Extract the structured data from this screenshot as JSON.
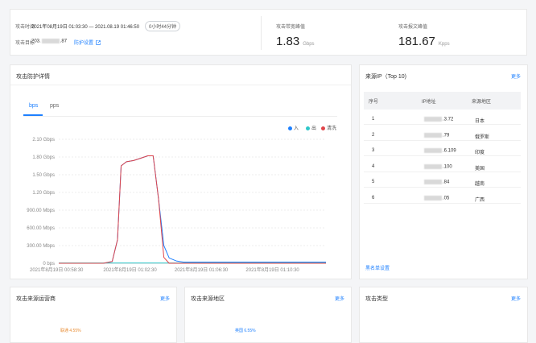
{
  "summary": {
    "attack_time_label": "攻击时间",
    "attack_time_value": "2021年08月19日 01:03:30 — 2021.08.19 01:46:50",
    "duration": "0小时44分钟",
    "attack_target_label": "攻击目标",
    "target_ip_prefix": "203.",
    "target_ip_suffix": ".87",
    "protect_settings_link": "防护设置",
    "bandwidth_peak_label": "攻击带宽峰值",
    "bandwidth_peak_value": "1.83",
    "bandwidth_peak_unit": "Gbps",
    "packet_peak_label": "攻击报文峰值",
    "packet_peak_value": "181.67",
    "packet_peak_unit": "Kpps"
  },
  "protection": {
    "title": "攻击防护详情",
    "tabs": [
      "bps",
      "pps"
    ],
    "active_tab": "bps",
    "legend": [
      {
        "name": "入",
        "color": "#1e80ff"
      },
      {
        "name": "出",
        "color": "#2ec7c9"
      },
      {
        "name": "清洗",
        "color": "#e0454a"
      }
    ]
  },
  "chart_data": {
    "type": "line",
    "title": "",
    "xlabel": "",
    "ylabel": "",
    "y_tick_labels": [
      "0 bps",
      "300.00 Mbps",
      "600.00 Mbps",
      "900.00 Mbps",
      "1.20 Gbps",
      "1.50 Gbps",
      "1.80 Gbps",
      "2.10 Gbps"
    ],
    "y_ticks_mbps": [
      0,
      300,
      600,
      900,
      1200,
      1500,
      1800,
      2100
    ],
    "ylim_mbps": [
      0,
      2100
    ],
    "x_tick_labels": [
      "2021年8月19日 00:58:30",
      "2021年8月19日 01:02:30",
      "2021年8月19日 01:06:30",
      "2021年8月19日 01:10:30"
    ],
    "x_minutes": [
      0,
      4,
      8,
      12
    ],
    "xlim_minutes": [
      0,
      15
    ],
    "grid": true,
    "legend_position": "top-right",
    "series": [
      {
        "name": "入",
        "color": "#1e80ff",
        "x": [
          0,
          2.5,
          3.0,
          3.3,
          3.5,
          3.8,
          4.2,
          4.6,
          5.0,
          5.3,
          5.6,
          5.9,
          6.2,
          6.6,
          7.0,
          15
        ],
        "values": [
          0,
          0,
          30,
          400,
          1650,
          1720,
          1740,
          1780,
          1820,
          1820,
          1100,
          300,
          90,
          40,
          20,
          20
        ]
      },
      {
        "name": "出",
        "color": "#2ec7c9",
        "x": [
          0,
          15
        ],
        "values": [
          5,
          5
        ]
      },
      {
        "name": "清洗",
        "color": "#e0454a",
        "x": [
          0,
          2.5,
          3.0,
          3.3,
          3.5,
          3.8,
          4.2,
          4.6,
          5.0,
          5.3,
          5.6,
          5.9,
          6.2,
          15
        ],
        "values": [
          0,
          0,
          30,
          400,
          1650,
          1720,
          1740,
          1780,
          1820,
          1820,
          1100,
          100,
          0,
          0
        ]
      }
    ]
  },
  "top_ip": {
    "title": "来源IP（Top 10)",
    "more": "更多",
    "columns": [
      "序号",
      "IP地址",
      "来源地区"
    ],
    "rows": [
      {
        "no": "1",
        "ip_suffix": ".3.72",
        "region": "日本"
      },
      {
        "no": "2",
        "ip_suffix": ".79",
        "region": "俄罗斯"
      },
      {
        "no": "3",
        "ip_suffix": ".6.109",
        "region": "印度"
      },
      {
        "no": "4",
        "ip_suffix": ".100",
        "region": "美国"
      },
      {
        "no": "5",
        "ip_suffix": ".84",
        "region": "越南"
      },
      {
        "no": "6",
        "ip_suffix": ".05",
        "region": "广西"
      }
    ],
    "blacklist_link": "黑名单设置"
  },
  "bottom": {
    "isp": {
      "title": "攻击来源运营商",
      "more": "更多",
      "peek_label": "联通 4.55%"
    },
    "region": {
      "title": "攻击来源地区",
      "more": "更多",
      "peek_label": "英国 6.55%"
    },
    "type": {
      "title": "攻击类型",
      "more": "更多"
    }
  }
}
